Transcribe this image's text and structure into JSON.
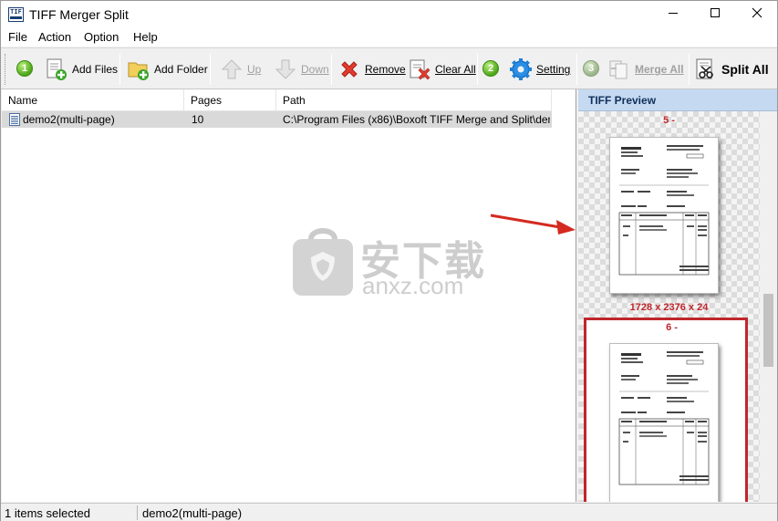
{
  "window": {
    "title": "TIFF Merger Split",
    "icon": "tiff-app-icon",
    "icon_text": "TIF"
  },
  "menu": {
    "items": [
      "File",
      "Action",
      "Option",
      "Help"
    ]
  },
  "toolbar": {
    "step1": "1",
    "add_files": "Add Files",
    "add_folder": "Add Folder",
    "up": "Up",
    "down": "Down",
    "remove": "Remove",
    "clear_all": "Clear All",
    "step2": "2",
    "setting": "Setting",
    "step3": "3",
    "merge_all": "Merge All",
    "split_all": "Split All"
  },
  "list": {
    "columns": [
      "Name",
      "Pages",
      "Path"
    ],
    "rows": [
      {
        "name": "demo2(multi-page)",
        "pages": "10",
        "path": "C:\\Program Files (x86)\\Boxoft TIFF Merge and Split\\demo..."
      }
    ]
  },
  "preview": {
    "title": "TIFF Preview",
    "pages": [
      {
        "label": "5 -",
        "dims": "1728 x 2376 x 24",
        "selected": false
      },
      {
        "label": "6 -",
        "selected": true
      }
    ]
  },
  "watermark": {
    "text_cn": "安下载",
    "text_en": "anxz.com"
  },
  "status": {
    "selection": "1 items selected",
    "current": "demo2(multi-page)"
  },
  "colors": {
    "accent_red": "#c0262c",
    "preview_header": "#c5d9f1",
    "step_green": "#4ea61a"
  }
}
